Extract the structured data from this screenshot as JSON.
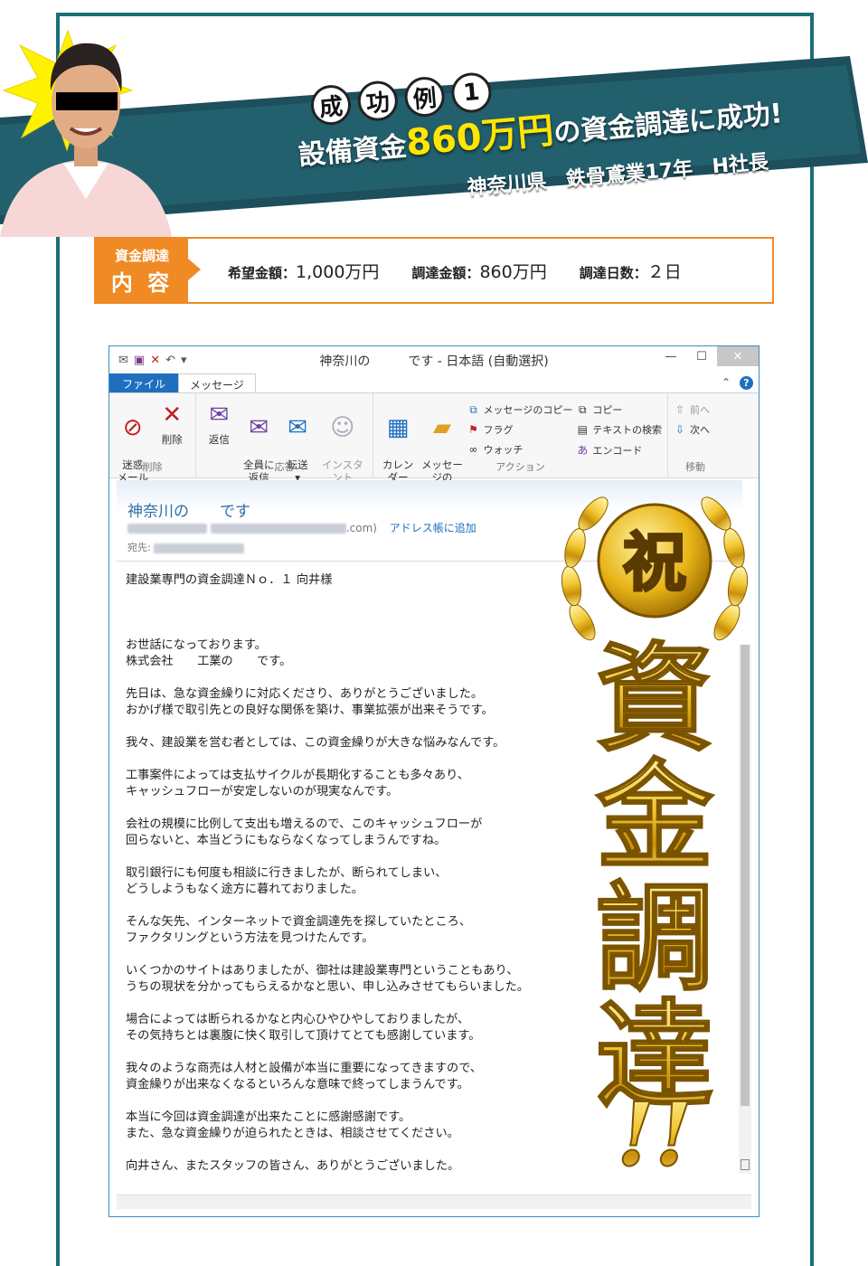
{
  "banner": {
    "seikou": [
      "成",
      "功",
      "例",
      "1"
    ],
    "headline_pre": "設備資金",
    "headline_amount": "860万円",
    "headline_post": "の資金調達に成功!",
    "subline": "神奈川県 鉄骨鳶業17年 H社長",
    "exclaim": "!"
  },
  "info": {
    "tag_line1": "資金調達",
    "tag_line2": "内 容",
    "items": [
      {
        "key": "希望金額：",
        "value": "1,000万円"
      },
      {
        "key": "調達金額：",
        "value": "860万円"
      },
      {
        "key": "調達日数：",
        "value": "２日"
      }
    ]
  },
  "window": {
    "title": "神奈川の　　　です - 日本語 (自動選択)",
    "tabs": {
      "file": "ファイル",
      "message": "メッセージ"
    },
    "ribbon": {
      "delete_group": "削除",
      "junk": "迷惑\nメール ▾",
      "delete": "削除",
      "respond_group": "応答",
      "reply": "返信",
      "reply_all": "全員に\n返信",
      "forward": "転送\n▾",
      "instant_message": "インスタント\nメッセージ",
      "actions_group": "アクション",
      "add_calendar": "カレンダー\nに追加",
      "move_message": "メッセージの\n移動",
      "copy_message": "メッセージのコピー",
      "flag": "フラグ",
      "watch": "ウォッチ",
      "copy": "コピー",
      "find_text": "テキストの検索",
      "encode": "エンコード",
      "move_group": "移動",
      "prev": "前へ",
      "next": "次へ"
    },
    "mail": {
      "subject": "神奈川の　　です",
      "from_suffix": ".com)",
      "add_address": "アドレス帳に追加",
      "to_label": "宛先:",
      "greeting": "建設業専門の資金調達Ｎｏ．１ 向井様",
      "paragraphs": [
        "お世話になっております。\n株式会社　　工業の　　です。",
        "先日は、急な資金繰りに対応くださり、ありがとうございました。\nおかげ様で取引先との良好な関係を築け、事業拡張が出来そうです。",
        "我々、建設業を営む者としては、この資金繰りが大きな悩みなんです。",
        "工事案件によっては支払サイクルが長期化することも多々あり、\nキャッシュフローが安定しないのが現実なんです。",
        "会社の規模に比例して支出も増えるので、このキャッシュフローが\n回らないと、本当どうにもならなくなってしまうんですね。",
        "取引銀行にも何度も相談に行きましたが、断られてしまい、\nどうしようもなく途方に暮れておりました。",
        "そんな矢先、インターネットで資金調達先を探していたところ、\nファクタリングという方法を見つけたんです。",
        "いくつかのサイトはありましたが、御社は建設業専門ということもあり、\nうちの現状を分かってもらえるかなと思い、申し込みさせてもらいました。",
        "場合によっては断られるかなと内心ひやひやしておりましたが、\nその気持ちとは裏腹に快く取引して頂けてとても感謝しています。",
        "我々のような商売は人材と設備が本当に重要になってきますので、\n資金繰りが出来なくなるといろんな意味で終ってしまうんです。",
        "本当に今回は資金調達が出来たことに感謝感謝です。\nまた、急な資金繰りが迫られたときは、相談させてください。",
        "向井さん、またスタッフの皆さん、ありがとうございました。"
      ]
    }
  },
  "badge": {
    "medal": "祝",
    "chars": [
      "資",
      "金",
      "調",
      "達"
    ],
    "exclaim": "!!"
  },
  "colors": {
    "frame": "#1a6f78",
    "banner_dark": "#1d4f5c",
    "orange": "#f08a24",
    "yellow": "#ffe600",
    "outlook_blue": "#1e6fc0"
  }
}
